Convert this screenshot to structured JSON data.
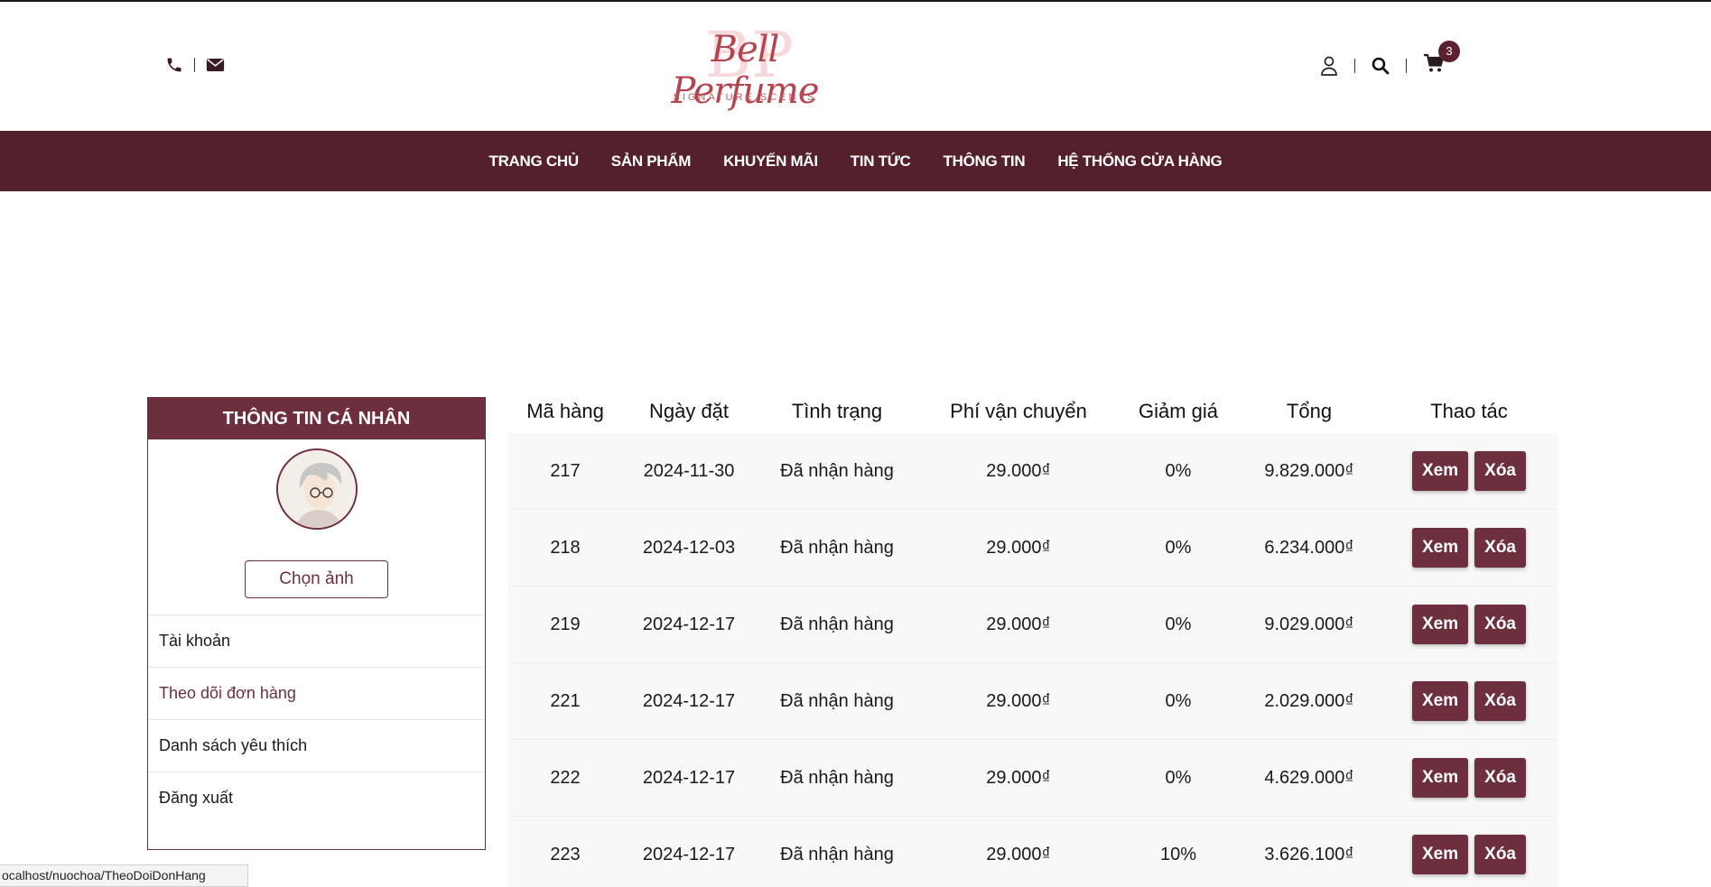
{
  "header": {
    "logo_text": "Bell Perfume",
    "logo_monogram": "BP",
    "logo_tagline": "SIGNATURE SCENTS",
    "cart_count": "3"
  },
  "nav": {
    "items": [
      "TRANG CHỦ",
      "SẢN PHẨM",
      "KHUYẾN MÃI",
      "TIN TỨC",
      "THÔNG TIN",
      "HỆ THỐNG CỬA HÀNG"
    ]
  },
  "profile": {
    "title": "THÔNG TIN CÁ NHÂN",
    "choose_photo": "Chọn ảnh",
    "menu": [
      "Tài khoản",
      "Theo dõi đơn hàng",
      "Danh sách yêu thích",
      "Đăng xuất"
    ]
  },
  "orders": {
    "columns": [
      "Mã hàng",
      "Ngày đặt",
      "Tình trạng",
      "Phí vận chuyển",
      "Giảm giá",
      "Tổng",
      "Thao tác"
    ],
    "view_label": "Xem",
    "delete_label": "Xóa",
    "rows": [
      {
        "id": "217",
        "date": "2024-11-30",
        "status": "Đã nhận hàng",
        "shipping": "29.000₫",
        "discount": "0%",
        "total": "9.829.000₫"
      },
      {
        "id": "218",
        "date": "2024-12-03",
        "status": "Đã nhận hàng",
        "shipping": "29.000₫",
        "discount": "0%",
        "total": "6.234.000₫"
      },
      {
        "id": "219",
        "date": "2024-12-17",
        "status": "Đã nhận hàng",
        "shipping": "29.000₫",
        "discount": "0%",
        "total": "9.029.000₫"
      },
      {
        "id": "221",
        "date": "2024-12-17",
        "status": "Đã nhận hàng",
        "shipping": "29.000₫",
        "discount": "0%",
        "total": "2.029.000₫"
      },
      {
        "id": "222",
        "date": "2024-12-17",
        "status": "Đã nhận hàng",
        "shipping": "29.000₫",
        "discount": "0%",
        "total": "4.629.000₫"
      },
      {
        "id": "223",
        "date": "2024-12-17",
        "status": "Đã nhận hàng",
        "shipping": "29.000₫",
        "discount": "10%",
        "total": "3.626.100₫"
      }
    ]
  },
  "statusbar": {
    "url": "ocalhost/nuochoa/TheoDoiDonHang"
  },
  "colors": {
    "brand": "#6d2e3e",
    "nav_bg": "#54202b",
    "logo": "#b2454d"
  }
}
